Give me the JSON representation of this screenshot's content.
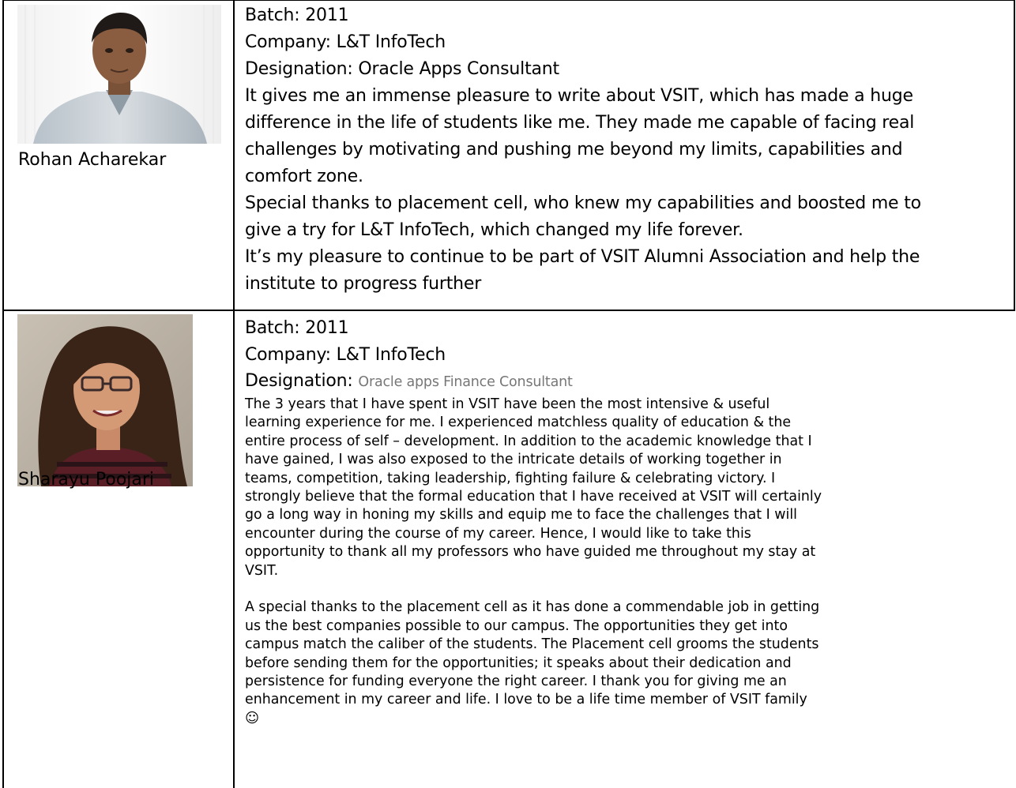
{
  "entries": [
    {
      "name": "Rohan Acharekar",
      "batch": "Batch: 2011",
      "company": "Company:  L&T InfoTech",
      "designation": "Designation: Oracle Apps Consultant",
      "lines": [
        "It gives me an immense pleasure to write about VSIT, which has made a huge",
        "difference in the life of students like me. They made me capable of facing real",
        "challenges by motivating and pushing me beyond my limits, capabilities and",
        "comfort zone.",
        "Special thanks to placement cell, who knew my capabilities and boosted me to",
        "give a try for L&T InfoTech, which changed my life forever.",
        "It’s my pleasure to continue to be part of VSIT Alumni Association and help the",
        "institute to progress  further"
      ]
    },
    {
      "name": "Sharayu Poojari",
      "batch": "Batch: 2011",
      "company": "Company:  L&T InfoTech",
      "designation_label": "Designation: ",
      "designation_value": "Oracle apps Finance Consultant",
      "para1": [
        "The 3 years that I have spent in VSIT have been the most intensive & useful",
        "learning experience for me. I experienced matchless quality of education & the",
        "entire process of self – development. In addition to the academic knowledge that I",
        "have gained, I was also exposed to the intricate details of working together in",
        "teams, competition, taking leadership, fighting failure & celebrating victory. I",
        "strongly believe that the formal education that I have received at VSIT will certainly",
        "go a long way in honing my skills and equip me to face the challenges that I will",
        "encounter during the course of my career. Hence, I would like to take this",
        "opportunity to thank all my professors who have guided me throughout my stay at",
        "VSIT."
      ],
      "para2": [
        "A special thanks to the placement cell as it has done a commendable job in getting",
        "us the best companies possible to our campus. The opportunities they get into",
        "campus match the caliber of the students. The Placement cell grooms the students",
        "before sending them for the opportunities; it speaks about their dedication and",
        "persistence for funding everyone the right career. I thank you for giving me an",
        "enhancement in my career and life. I love to be a life time member of VSIT family",
        "☺"
      ]
    }
  ]
}
